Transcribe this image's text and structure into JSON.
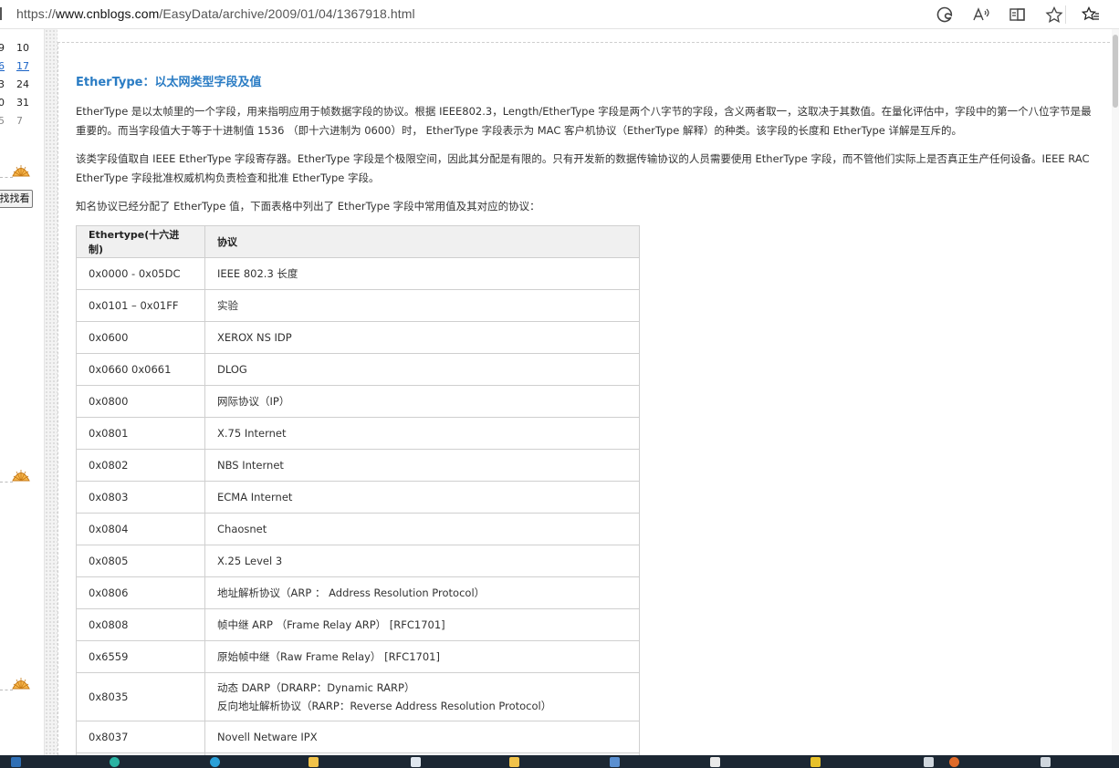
{
  "browser": {
    "url_prefix": "https://",
    "url_host": "www.cnblogs.com",
    "url_path": "/EasyData/archive/2009/01/04/1367918.html",
    "toolbar_icons": [
      "edge-icon",
      "read-aloud-icon",
      "immersive-reader-icon",
      "favorite-star-icon",
      "favorites-list-icon"
    ],
    "toolbar_glyphs": {
      "edge": "◎",
      "read_aloud": "A",
      "immersive": "⧉",
      "star": "☆",
      "favorites": "☆"
    }
  },
  "sidebar": {
    "calendar_rows": [
      {
        "a": "9",
        "b": "10",
        "b_link": false
      },
      {
        "a": "6",
        "b": "17",
        "b_link": true
      },
      {
        "a": "3",
        "b": "24",
        "b_link": false
      },
      {
        "a": "0",
        "b": "31",
        "b_link": false
      },
      {
        "a": "5",
        "b": "7",
        "b_link": false
      }
    ],
    "search_button": "找找看"
  },
  "article": {
    "title": "EtherType：以太网类型字段及值",
    "para1": "EtherType 是以太帧里的一个字段，用来指明应用于帧数据字段的协议。根据 IEEE802.3，Length/EtherType 字段是两个八字节的字段，含义两者取一，这取决于其数值。在量化评估中，字段中的第一个八位字节是最重要的。而当字段值大于等于十进制值 1536 （即十六进制为 0600）时， EtherType 字段表示为 MAC 客户机协议（EtherType 解释）的种类。该字段的长度和 EtherType 详解是互斥的。",
    "para2": "该类字段值取自 IEEE EtherType 字段寄存器。EtherType 字段是个极限空间，因此其分配是有限的。只有开发新的数据传输协议的人员需要使用 EtherType 字段，而不管他们实际上是否真正生产任何设备。IEEE RAC EtherType 字段批准权威机构负责检查和批准 EtherType 字段。",
    "para3": "知名协议已经分配了 EtherType 值，下面表格中列出了 EtherType 字段中常用值及其对应的协议：",
    "table": {
      "headers": [
        "Ethertype(十六进制)",
        "协议"
      ],
      "rows": [
        {
          "code": "0x0000 - 0x05DC",
          "protocol": "IEEE 802.3 长度"
        },
        {
          "code": "0x0101 – 0x01FF",
          "protocol": "实验"
        },
        {
          "code": "0x0600",
          "protocol": "XEROX NS IDP"
        },
        {
          "code": "0x0660 0x0661",
          "protocol": "DLOG"
        },
        {
          "code": "0x0800",
          "protocol": "网际协议（IP）"
        },
        {
          "code": "0x0801",
          "protocol": "X.75 Internet"
        },
        {
          "code": "0x0802",
          "protocol": "NBS Internet"
        },
        {
          "code": "0x0803",
          "protocol": "ECMA Internet"
        },
        {
          "code": "0x0804",
          "protocol": "Chaosnet"
        },
        {
          "code": "0x0805",
          "protocol": "X.25 Level 3"
        },
        {
          "code": "0x0806",
          "protocol": "地址解析协议（ARP ： Address Resolution Protocol）"
        },
        {
          "code": "0x0808",
          "protocol": "帧中继 ARP （Frame Relay ARP） [RFC1701]"
        },
        {
          "code": "0x6559",
          "protocol": "原始帧中继（Raw Frame Relay） [RFC1701]"
        },
        {
          "code": "0x8035",
          "protocol": "动态 DARP（DRARP：Dynamic RARP）",
          "protocol2": "反向地址解析协议（RARP：Reverse Address Resolution Protocol）"
        },
        {
          "code": "0x8037",
          "protocol": "Novell Netware IPX"
        },
        {
          "code": "",
          "protocol": ""
        }
      ]
    }
  },
  "colors": {
    "title": "#2a7cc4",
    "link": "#1a63c6",
    "taskbar": "#1c2733"
  }
}
